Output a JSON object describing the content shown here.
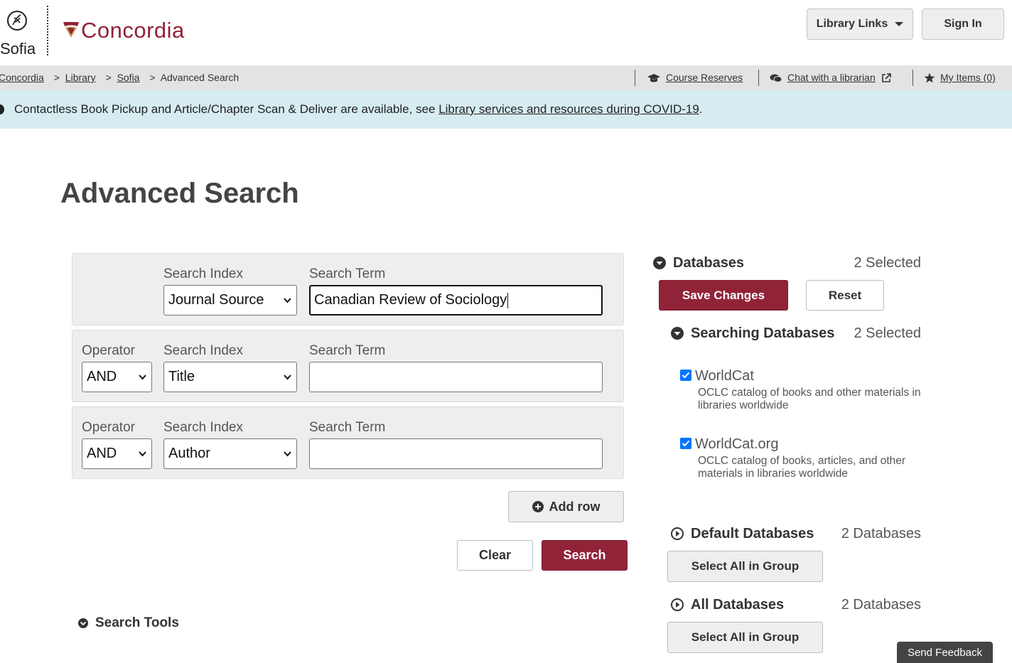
{
  "header": {
    "sofia_logo_text": "Sofia",
    "concordia_logo_text": "Concordia",
    "library_links_label": "Library Links",
    "sign_in_label": "Sign In"
  },
  "breadcrumb": {
    "items": [
      "Concordia",
      "Library",
      "Sofia"
    ],
    "current": "Advanced Search",
    "separator": ">"
  },
  "utility": {
    "course_reserves": "Course Reserves",
    "chat": "Chat with a librarian",
    "my_items": "My Items (0)"
  },
  "alert": {
    "text": "Contactless Book Pickup and Article/Chapter Scan & Deliver are available, see ",
    "link": "Library services and resources during COVID-19",
    "suffix": "."
  },
  "page_title": "Advanced Search",
  "search": {
    "rows": [
      {
        "operator_label": "",
        "operator": "",
        "index_label": "Search Index",
        "index": "Journal Source",
        "term_label": "Search Term",
        "term": "Canadian Review of Sociology"
      },
      {
        "operator_label": "Operator",
        "operator": "AND",
        "index_label": "Search Index",
        "index": "Title",
        "term_label": "Search Term",
        "term": ""
      },
      {
        "operator_label": "Operator",
        "operator": "AND",
        "index_label": "Search Index",
        "index": "Author",
        "term_label": "Search Term",
        "term": ""
      }
    ],
    "add_row_label": "Add row",
    "clear_label": "Clear",
    "search_label": "Search",
    "search_tools_label": "Search Tools"
  },
  "databases": {
    "title": "Databases",
    "selected_count": "2 Selected",
    "save_label": "Save Changes",
    "reset_label": "Reset",
    "searching": {
      "title": "Searching Databases",
      "count": "2 Selected",
      "items": [
        {
          "name": "WorldCat",
          "desc": "OCLC catalog of books and other materials in libraries worldwide",
          "checked": true
        },
        {
          "name": "WorldCat.org",
          "desc": "OCLC catalog of books, articles, and other materials in libraries worldwide",
          "checked": true
        }
      ]
    },
    "default_group": {
      "title": "Default Databases",
      "count": "2 Databases",
      "button": "Select All in Group"
    },
    "all_group": {
      "title": "All Databases",
      "count": "2 Databases",
      "button": "Select All in Group"
    }
  },
  "feedback_label": "Send Feedback",
  "colors": {
    "brand": "#912338",
    "alert_bg": "#d7ecf1",
    "crumb_bg": "#e3e3e3",
    "checkbox": "#0075ff"
  }
}
